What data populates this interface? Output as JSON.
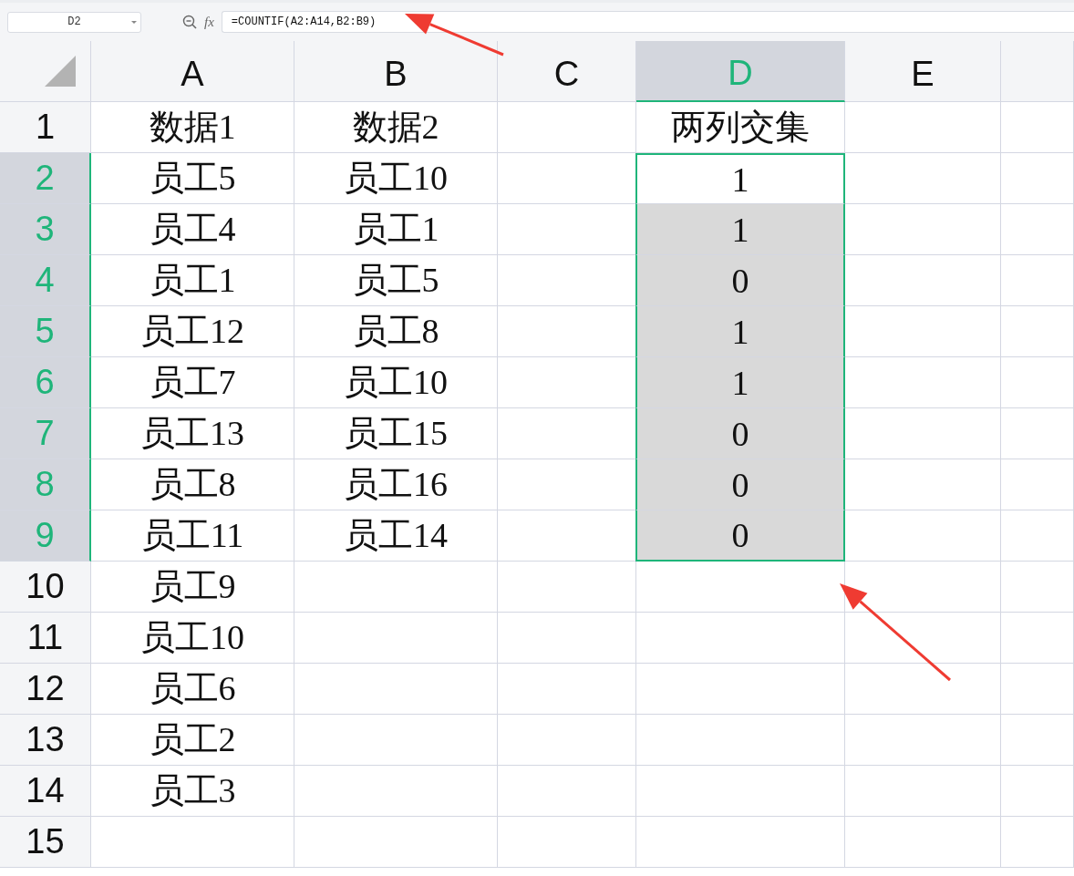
{
  "name_box": "D2",
  "fx_label": "fx",
  "formula": "=COUNTIF(A2:A14,B2:B9)",
  "columns": [
    {
      "label": "A",
      "selected": false
    },
    {
      "label": "B",
      "selected": false
    },
    {
      "label": "C",
      "selected": false
    },
    {
      "label": "D",
      "selected": true
    },
    {
      "label": "E",
      "selected": false
    }
  ],
  "rows": [
    {
      "label": "1",
      "selected": false,
      "a": "数据1",
      "b": "数据2",
      "d": "两列交集"
    },
    {
      "label": "2",
      "selected": true,
      "active": true,
      "a": "员工5",
      "b": "员工10",
      "d": "1"
    },
    {
      "label": "3",
      "selected": true,
      "a": "员工4",
      "b": "员工1",
      "d": "1"
    },
    {
      "label": "4",
      "selected": true,
      "a": "员工1",
      "b": "员工5",
      "d": "0"
    },
    {
      "label": "5",
      "selected": true,
      "a": "员工12",
      "b": "员工8",
      "d": "1"
    },
    {
      "label": "6",
      "selected": true,
      "a": "员工7",
      "b": "员工10",
      "d": "1"
    },
    {
      "label": "7",
      "selected": true,
      "a": "员工13",
      "b": "员工15",
      "d": "0"
    },
    {
      "label": "8",
      "selected": true,
      "a": "员工8",
      "b": "员工16",
      "d": "0"
    },
    {
      "label": "9",
      "selected": true,
      "a": "员工11",
      "b": "员工14",
      "d": "0"
    },
    {
      "label": "10",
      "selected": false,
      "a": "员工9"
    },
    {
      "label": "11",
      "selected": false,
      "a": "员工10"
    },
    {
      "label": "12",
      "selected": false,
      "a": "员工6"
    },
    {
      "label": "13",
      "selected": false,
      "a": "员工2"
    },
    {
      "label": "14",
      "selected": false,
      "a": "员工3"
    },
    {
      "label": "15",
      "selected": false
    }
  ]
}
